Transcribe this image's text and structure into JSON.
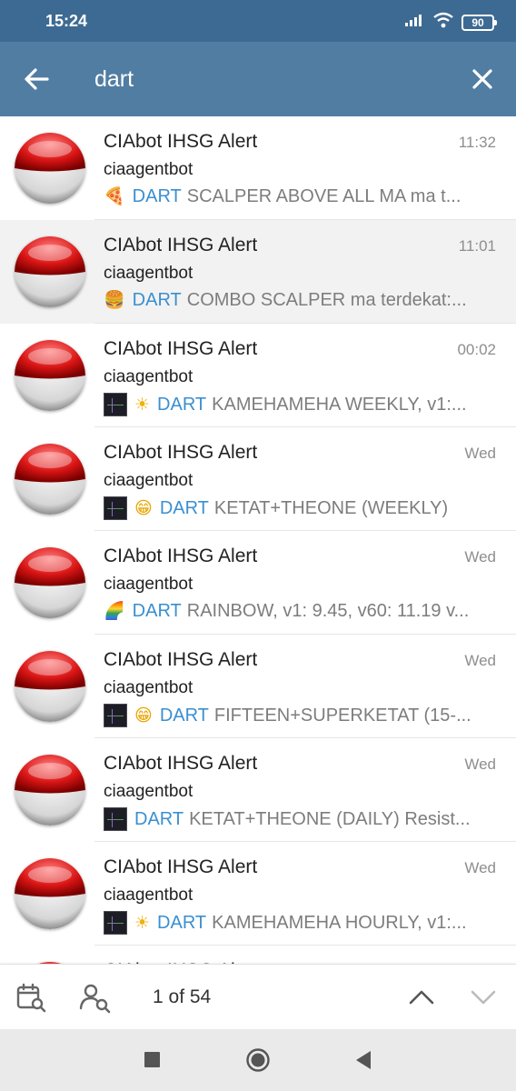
{
  "status_bar": {
    "time": "15:24",
    "battery": "90",
    "icons": [
      "signal-icon",
      "wifi-icon",
      "battery-icon"
    ]
  },
  "search": {
    "query": "dart",
    "back_icon": "arrow-left-icon",
    "clear_icon": "close-icon"
  },
  "colors": {
    "header": "#527da3",
    "status_bar": "#3d6a92",
    "keyword": "#3a8fd0"
  },
  "results": [
    {
      "title": "CIAbot IHSG Alert",
      "time": "11:32",
      "sender": "ciaagentbot",
      "emoji": "🍕",
      "keyword": "DART",
      "text": "SCALPER ABOVE ALL MA ma t...",
      "has_thumb": false
    },
    {
      "title": "CIAbot IHSG Alert",
      "time": "11:01",
      "sender": "ciaagentbot",
      "emoji": "🍔",
      "keyword": "DART",
      "text": "COMBO SCALPER ma terdekat:...",
      "has_thumb": false
    },
    {
      "title": "CIAbot IHSG Alert",
      "time": "00:02",
      "sender": "ciaagentbot",
      "emoji": "☀",
      "keyword": "DART",
      "text": "KAMEHAMEHA WEEKLY, v1:...",
      "has_thumb": true
    },
    {
      "title": "CIAbot IHSG Alert",
      "time": "Wed",
      "sender": "ciaagentbot",
      "emoji": "😁",
      "keyword": "DART",
      "text": "KETAT+THEONE (WEEKLY)",
      "has_thumb": true
    },
    {
      "title": "CIAbot IHSG Alert",
      "time": "Wed",
      "sender": "ciaagentbot",
      "emoji": "🌈",
      "keyword": "DART",
      "text": "RAINBOW, v1: 9.45, v60: 11.19 v...",
      "has_thumb": false
    },
    {
      "title": "CIAbot IHSG Alert",
      "time": "Wed",
      "sender": "ciaagentbot",
      "emoji": "😁",
      "keyword": "DART",
      "text": "FIFTEEN+SUPERKETAT (15-...",
      "has_thumb": true
    },
    {
      "title": "CIAbot IHSG Alert",
      "time": "Wed",
      "sender": "ciaagentbot",
      "emoji": "",
      "keyword": "DART",
      "text": "KETAT+THEONE (DAILY) Resist...",
      "has_thumb": true
    },
    {
      "title": "CIAbot IHSG Alert",
      "time": "Wed",
      "sender": "ciaagentbot",
      "emoji": "☀",
      "keyword": "DART",
      "text": "KAMEHAMEHA HOURLY, v1:...",
      "has_thumb": true
    }
  ],
  "partial_row": {
    "title": "CIAbot IHSG Alert",
    "time": "Wed"
  },
  "bottom_bar": {
    "counter": "1 of 54",
    "icons": [
      "calendar-search-icon",
      "user-search-icon",
      "chevron-up-icon",
      "chevron-down-icon"
    ]
  },
  "nav_bar": {
    "icons": [
      "recents-square-icon",
      "home-circle-icon",
      "back-triangle-icon"
    ]
  }
}
